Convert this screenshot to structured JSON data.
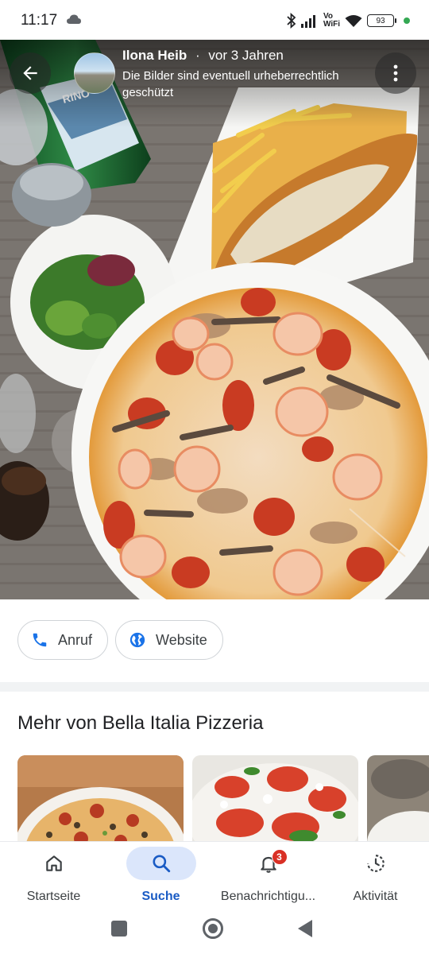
{
  "status_bar": {
    "time": "11:17",
    "vowifi_top": "Vo",
    "vowifi_bottom": "WiFi",
    "battery": "93",
    "icons": [
      "cloud-icon",
      "bluetooth-icon",
      "signal-icon",
      "wifi-icon",
      "battery-icon",
      "privacy-dot-icon"
    ]
  },
  "photo_header": {
    "author": "Ilona Heib",
    "separator": "·",
    "age": "vor 3 Jahren",
    "rights_notice": "Die Bilder sind eventuell urheberrechtlich geschützt",
    "icons": [
      "back-arrow-icon",
      "more-vert-icon"
    ]
  },
  "actions": {
    "call_label": "Anruf",
    "website_label": "Website",
    "icons": [
      "phone-icon",
      "globe-icon"
    ],
    "accent": "#1a73e8"
  },
  "section": {
    "title": "Mehr von Bella Italia Pizzeria"
  },
  "bottom_nav": {
    "items": [
      {
        "label": "Startseite",
        "icon": "home-icon"
      },
      {
        "label": "Suche",
        "icon": "search-icon",
        "active": true
      },
      {
        "label": "Benachrichtigu...",
        "icon": "bell-icon",
        "badge": "3"
      },
      {
        "label": "Aktivität",
        "icon": "activity-icon"
      }
    ],
    "active_color": "#1a5bc4"
  }
}
